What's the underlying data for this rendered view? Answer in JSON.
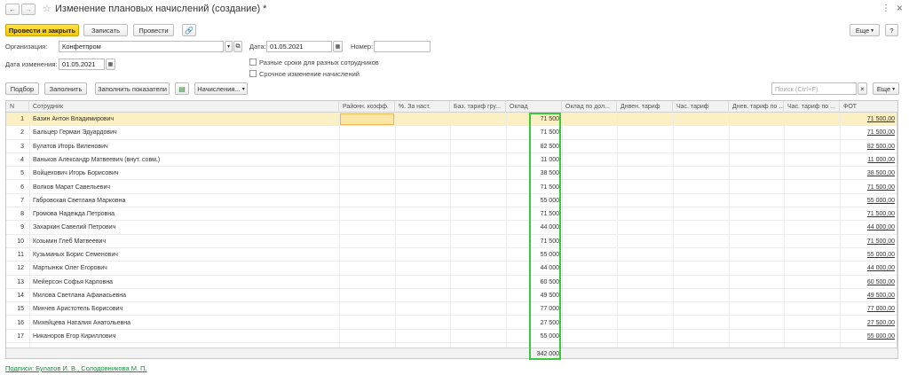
{
  "window": {
    "title": "Изменение плановых начислений (создание) *",
    "nav_back": "←",
    "nav_forward": "→",
    "star": "☆",
    "more_menu": "⋮",
    "close": "×"
  },
  "toolbar": {
    "post_close": "Провести и закрыть",
    "save": "Записать",
    "post": "Провести",
    "more": "Еще",
    "help": "?"
  },
  "form": {
    "org_label": "Организация:",
    "org_value": "Конфетпром",
    "date_label": "Дата:",
    "date_value": "01.05.2021",
    "number_label": "Номер:",
    "number_value": "",
    "change_date_label": "Дата изменения:",
    "change_date_value": "01.05.2021",
    "check1_label": "Разные сроки для разных сотрудников",
    "check2_label": "Срочное изменение начислений"
  },
  "table_toolbar": {
    "pick": "Подбор",
    "fill": "Заполнить",
    "fill_indicators": "Заполнить показатели",
    "accruals": "Начисления...",
    "search_placeholder": "Поиск (Ctrl+F)",
    "more": "Еще"
  },
  "table": {
    "columns": [
      "N",
      "Сотрудник",
      "Районн. коэфф.",
      "%. За наст.",
      "Баз. тариф гру...",
      "Оклад",
      "Оклад по дол...",
      "Днвен. тариф",
      "Час. тариф",
      "Днев. тариф по ...",
      "Час. тариф по ...",
      "ФОТ"
    ],
    "rows": [
      {
        "n": "1",
        "name": "Базин Антон Владимирович",
        "salary": "71 500",
        "fot": "71 500,00"
      },
      {
        "n": "2",
        "name": "Бальцер Герман Эдуардович",
        "salary": "71 500",
        "fot": "71 500,00"
      },
      {
        "n": "3",
        "name": "Булатов Игорь Виленович",
        "salary": "82 500",
        "fot": "82 500,00"
      },
      {
        "n": "4",
        "name": "Ваньков Александр Матвеевич (внут. совм.)",
        "salary": "11 000",
        "fot": "11 000,00"
      },
      {
        "n": "5",
        "name": "Войцехович Игорь Борисович",
        "salary": "38 500",
        "fot": "38 500,00"
      },
      {
        "n": "6",
        "name": "Волков Марат Савельевич",
        "salary": "71 500",
        "fot": "71 500,00"
      },
      {
        "n": "7",
        "name": "Габровская Светлана Марковна",
        "salary": "55 000",
        "fot": "55 000,00"
      },
      {
        "n": "8",
        "name": "Громова Надежда Петровна",
        "salary": "71 500",
        "fot": "71 500,00"
      },
      {
        "n": "9",
        "name": "Захаркин Савелий Петрович",
        "salary": "44 000",
        "fot": "44 000,00"
      },
      {
        "n": "10",
        "name": "Козьмин Глеб Матвеевич",
        "salary": "71 500",
        "fot": "71 500,00"
      },
      {
        "n": "11",
        "name": "Кузьминых Борис Семенович",
        "salary": "55 000",
        "fot": "55 000,00"
      },
      {
        "n": "12",
        "name": "Мартынюк Олег Егорович",
        "salary": "44 000",
        "fot": "44 000,00"
      },
      {
        "n": "13",
        "name": "Мейерсон Софья Карловна",
        "salary": "60 500",
        "fot": "60 500,00"
      },
      {
        "n": "14",
        "name": "Милова Светлана Афанасьевна",
        "salary": "49 500",
        "fot": "49 500,00"
      },
      {
        "n": "15",
        "name": "Минчев Аристотель Борисович",
        "salary": "77 000",
        "fot": "77 000,00"
      },
      {
        "n": "16",
        "name": "Михейцева Наталия Анатольевна",
        "salary": "27 500",
        "fot": "27 500,00"
      },
      {
        "n": "17",
        "name": "Никаноров Егор Кириллович",
        "salary": "55 000",
        "fot": "55 000,00"
      }
    ],
    "total_salary": "342 000"
  },
  "footer": {
    "signatures": "Подписи: Булатов И. В., Солодовникова М. П."
  },
  "colors": {
    "primary_button": "#f5c800",
    "highlight_box": "#3cc83c",
    "selected_row": "#fbefc4",
    "link": "#1a8a3a"
  }
}
